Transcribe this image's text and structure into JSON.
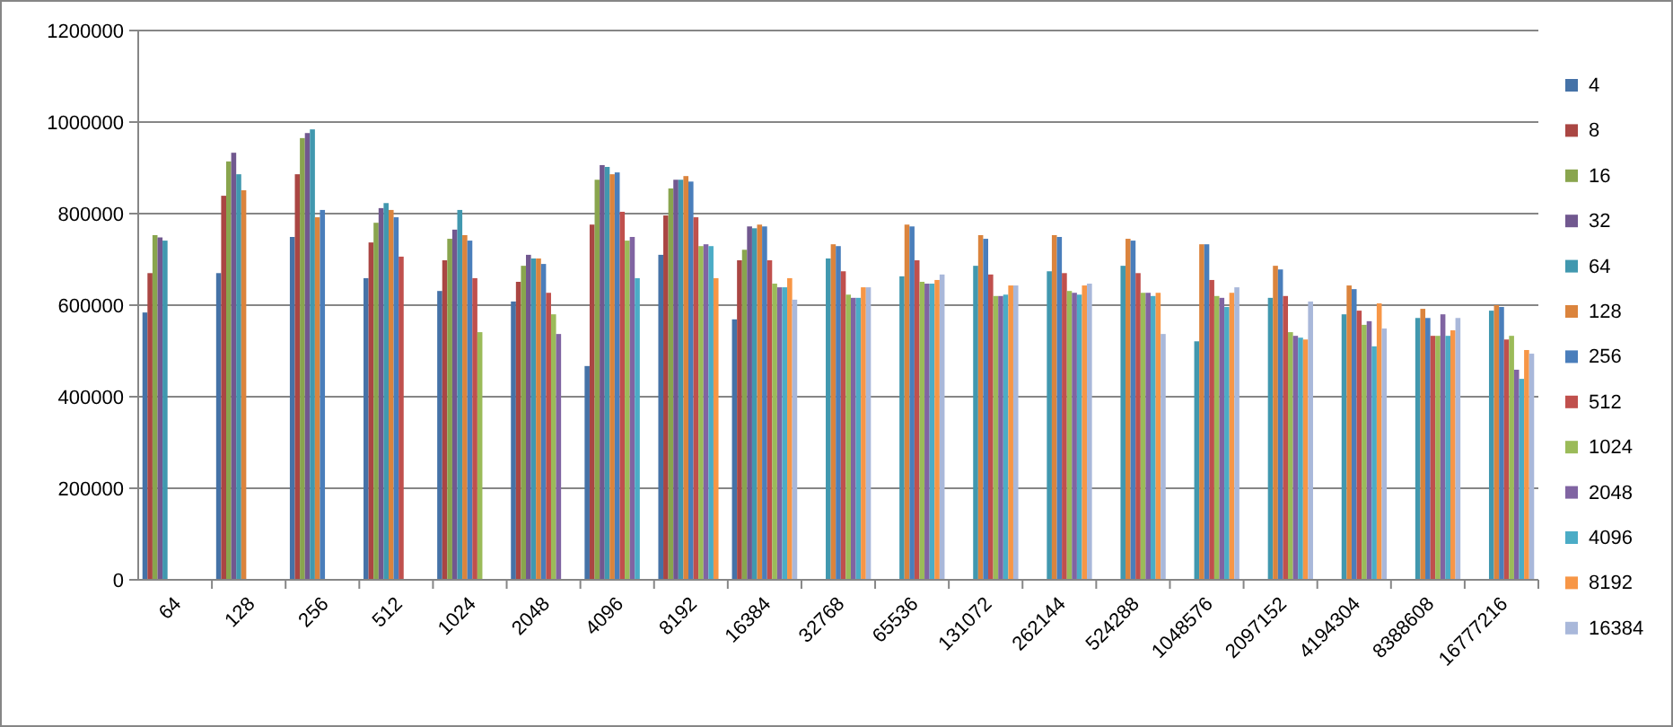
{
  "chart_data": {
    "type": "bar",
    "orientation": "vertical",
    "categories": [
      "64",
      "128",
      "256",
      "512",
      "1024",
      "2048",
      "4096",
      "8192",
      "16384",
      "32768",
      "65536",
      "131072",
      "262144",
      "524288",
      "1048576",
      "2097152",
      "4194304",
      "8388608",
      "16777216"
    ],
    "ylim": [
      0,
      1200000
    ],
    "grid": true,
    "legend": true,
    "yticks": [
      0,
      200000,
      400000,
      600000,
      800000,
      1000000,
      1200000
    ],
    "series": [
      {
        "name": "4",
        "color": "#4572a7",
        "values": [
          584000,
          670000,
          749000,
          659000,
          631000,
          608000,
          467000,
          710000,
          569000,
          null,
          null,
          null,
          null,
          null,
          null,
          null,
          null,
          null,
          null
        ]
      },
      {
        "name": "8",
        "color": "#aa4643",
        "values": [
          670000,
          839000,
          886000,
          737000,
          698000,
          651000,
          776000,
          796000,
          698000,
          null,
          null,
          null,
          null,
          null,
          null,
          null,
          null,
          null,
          null
        ]
      },
      {
        "name": "16",
        "color": "#89a54e",
        "values": [
          753000,
          914000,
          965000,
          780000,
          745000,
          686000,
          874000,
          855000,
          721000,
          null,
          null,
          null,
          null,
          null,
          null,
          null,
          null,
          null,
          null
        ]
      },
      {
        "name": "32",
        "color": "#71588f",
        "values": [
          748000,
          933000,
          976000,
          812000,
          765000,
          710000,
          906000,
          874000,
          772000,
          null,
          null,
          null,
          null,
          null,
          null,
          null,
          null,
          null,
          null
        ]
      },
      {
        "name": "64",
        "color": "#4198af",
        "values": [
          741000,
          886000,
          984000,
          823000,
          808000,
          702000,
          902000,
          874000,
          768000,
          702000,
          663000,
          686000,
          674000,
          686000,
          521000,
          616000,
          580000,
          572000,
          588000
        ]
      },
      {
        "name": "128",
        "color": "#db843d",
        "values": [
          null,
          851000,
          792000,
          808000,
          753000,
          702000,
          886000,
          882000,
          776000,
          733000,
          776000,
          753000,
          753000,
          745000,
          733000,
          686000,
          643000,
          592000,
          600000
        ]
      },
      {
        "name": "256",
        "color": "#4a7ebb",
        "values": [
          null,
          null,
          808000,
          792000,
          741000,
          690000,
          890000,
          870000,
          772000,
          729000,
          772000,
          745000,
          749000,
          741000,
          733000,
          678000,
          635000,
          572000,
          596000
        ]
      },
      {
        "name": "512",
        "color": "#c0504d",
        "values": [
          null,
          null,
          null,
          706000,
          659000,
          627000,
          804000,
          792000,
          698000,
          674000,
          698000,
          667000,
          670000,
          670000,
          655000,
          620000,
          588000,
          533000,
          525000
        ]
      },
      {
        "name": "1024",
        "color": "#9bbb59",
        "values": [
          null,
          null,
          null,
          null,
          541000,
          580000,
          741000,
          729000,
          647000,
          623000,
          651000,
          620000,
          631000,
          627000,
          620000,
          541000,
          557000,
          533000,
          533000
        ]
      },
      {
        "name": "2048",
        "color": "#8064a2",
        "values": [
          null,
          null,
          null,
          null,
          null,
          537000,
          749000,
          733000,
          639000,
          616000,
          647000,
          620000,
          627000,
          627000,
          616000,
          533000,
          565000,
          580000,
          459000
        ]
      },
      {
        "name": "4096",
        "color": "#4bacc6",
        "values": [
          null,
          null,
          null,
          null,
          null,
          null,
          659000,
          729000,
          639000,
          616000,
          647000,
          623000,
          623000,
          620000,
          596000,
          529000,
          510000,
          533000,
          439000
        ]
      },
      {
        "name": "8192",
        "color": "#f79646",
        "values": [
          null,
          null,
          null,
          null,
          null,
          null,
          null,
          659000,
          659000,
          639000,
          655000,
          643000,
          643000,
          627000,
          627000,
          525000,
          604000,
          545000,
          502000
        ]
      },
      {
        "name": "16384",
        "color": "#a9b8da",
        "values": [
          null,
          null,
          null,
          null,
          null,
          null,
          null,
          null,
          612000,
          639000,
          667000,
          643000,
          647000,
          537000,
          639000,
          608000,
          549000,
          572000,
          494000
        ]
      }
    ]
  }
}
